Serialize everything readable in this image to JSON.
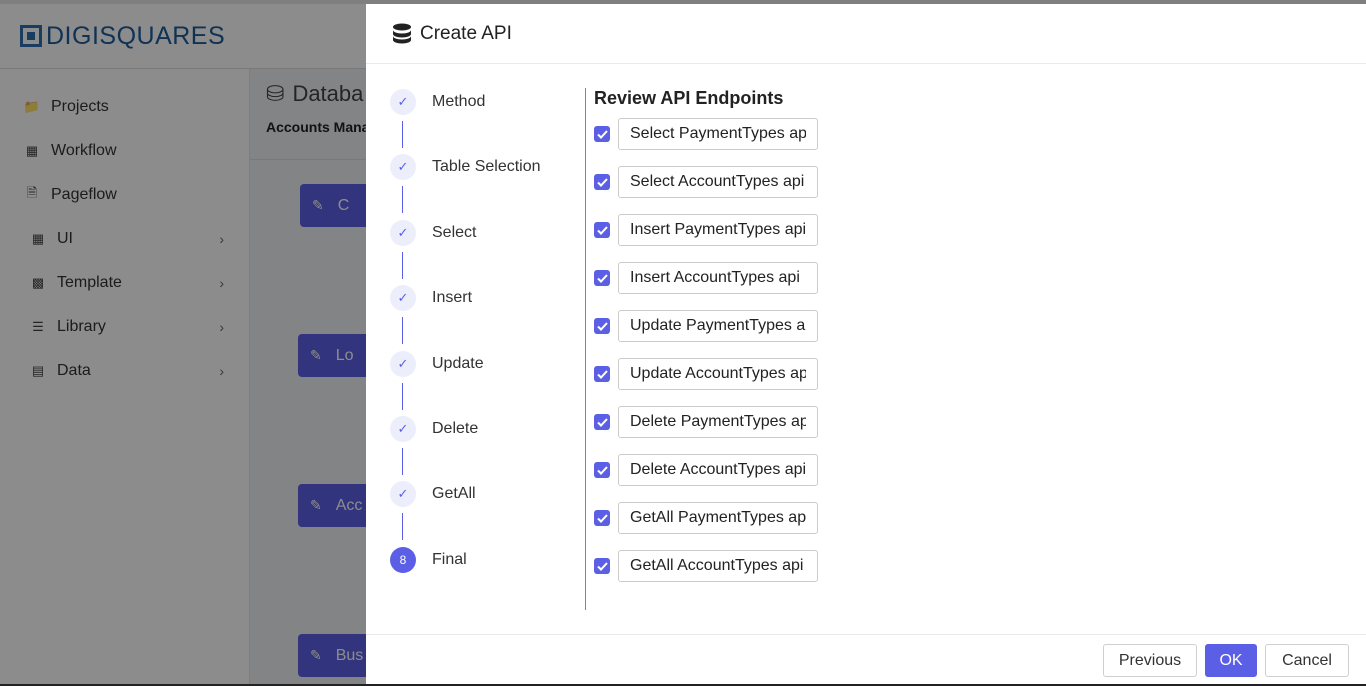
{
  "brand": {
    "name": "DIGISQUARES"
  },
  "sidebar": {
    "items": [
      {
        "label": "Projects",
        "icon": "folder-icon",
        "expandable": false
      },
      {
        "label": "Workflow",
        "icon": "workflow-icon",
        "expandable": false
      },
      {
        "label": "Pageflow",
        "icon": "pageflow-icon",
        "expandable": false
      },
      {
        "label": "UI",
        "icon": "ui-grid-icon",
        "expandable": true
      },
      {
        "label": "Template",
        "icon": "template-icon",
        "expandable": true
      },
      {
        "label": "Library",
        "icon": "library-icon",
        "expandable": true
      },
      {
        "label": "Data",
        "icon": "data-icon",
        "expandable": true
      }
    ]
  },
  "main": {
    "title": "Databa",
    "subtitle": "Accounts Mana",
    "cards": [
      {
        "label": "C"
      },
      {
        "label": "Lo"
      },
      {
        "label": "Acc"
      },
      {
        "label": "Bus"
      }
    ]
  },
  "drawer": {
    "title": "Create API",
    "steps": [
      {
        "label": "Method",
        "status": "done"
      },
      {
        "label": "Table Selection",
        "status": "done"
      },
      {
        "label": "Select",
        "status": "done"
      },
      {
        "label": "Insert",
        "status": "done"
      },
      {
        "label": "Update",
        "status": "done"
      },
      {
        "label": "Delete",
        "status": "done"
      },
      {
        "label": "GetAll",
        "status": "done"
      },
      {
        "label": "Final",
        "status": "active",
        "number": "8"
      }
    ],
    "review_title": "Review API Endpoints",
    "endpoints": [
      {
        "value": "Select PaymentTypes api",
        "checked": true
      },
      {
        "value": "Select AccountTypes api",
        "checked": true
      },
      {
        "value": "Insert PaymentTypes api",
        "checked": true
      },
      {
        "value": "Insert AccountTypes api",
        "checked": true
      },
      {
        "value": "Update PaymentTypes api",
        "checked": true
      },
      {
        "value": "Update AccountTypes api",
        "checked": true
      },
      {
        "value": "Delete PaymentTypes api",
        "checked": true
      },
      {
        "value": "Delete AccountTypes api",
        "checked": true
      },
      {
        "value": "GetAll PaymentTypes api",
        "checked": true
      },
      {
        "value": "GetAll AccountTypes api",
        "checked": true
      }
    ],
    "footer": {
      "previous_label": "Previous",
      "ok_label": "OK",
      "cancel_label": "Cancel"
    }
  },
  "colors": {
    "accent": "#5b5fe6",
    "brand": "#1e5c99",
    "overlay": "rgba(0,0,0,0.45)"
  }
}
